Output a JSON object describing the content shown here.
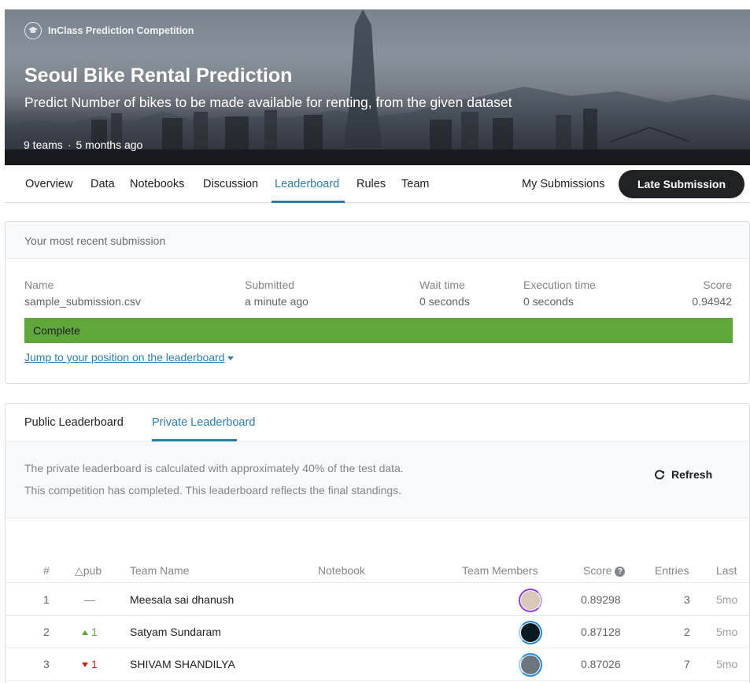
{
  "banner": {
    "competition_type": "InClass Prediction Competition",
    "title": "Seoul Bike Rental Prediction",
    "subtitle": "Predict Number of bikes to be made available for renting, from the given dataset",
    "teams": "9 teams",
    "separator": "·",
    "age": "5 months ago"
  },
  "tabs": {
    "items": [
      "Overview",
      "Data",
      "Notebooks",
      "Discussion",
      "Leaderboard",
      "Rules",
      "Team"
    ],
    "active": "Leaderboard",
    "my_submissions": "My Submissions",
    "late_submission": "Late Submission"
  },
  "recent_submission": {
    "heading": "Your most recent submission",
    "name_label": "Name",
    "name_value": "sample_submission.csv",
    "submitted_label": "Submitted",
    "submitted_value": "a minute ago",
    "wait_label": "Wait time",
    "wait_value": "0 seconds",
    "exec_label": "Execution time",
    "exec_value": "0 seconds",
    "score_label": "Score",
    "score_value": "0.94942",
    "status": "Complete",
    "status_color": "#5fa73b",
    "jump_link": "Jump to your position on the leaderboard"
  },
  "leaderboard": {
    "tab_public": "Public Leaderboard",
    "tab_private": "Private Leaderboard",
    "info_line1": "The private leaderboard is calculated with approximately 40% of the test data.",
    "info_line2": "This competition has completed. This leaderboard reflects the final standings.",
    "refresh": "Refresh",
    "columns": {
      "rank": "#",
      "delta": "△pub",
      "team": "Team Name",
      "notebook": "Notebook",
      "members": "Team Members",
      "score": "Score",
      "entries": "Entries",
      "last": "Last"
    },
    "rows": [
      {
        "rank": "1",
        "delta": "—",
        "delta_dir": "none",
        "team": "Meesala sai dhanush",
        "score": "0.89298",
        "entries": "3",
        "last": "5mo"
      },
      {
        "rank": "2",
        "delta": "1",
        "delta_dir": "up",
        "team": "Satyam Sundaram",
        "score": "0.87128",
        "entries": "2",
        "last": "5mo"
      },
      {
        "rank": "3",
        "delta": "1",
        "delta_dir": "down",
        "team": "SHIVAM SHANDILYA",
        "score": "0.87026",
        "entries": "7",
        "last": "5mo"
      }
    ]
  },
  "colors": {
    "accent": "#2e7da8",
    "up": "#5fa73b",
    "down": "#c5221f"
  }
}
